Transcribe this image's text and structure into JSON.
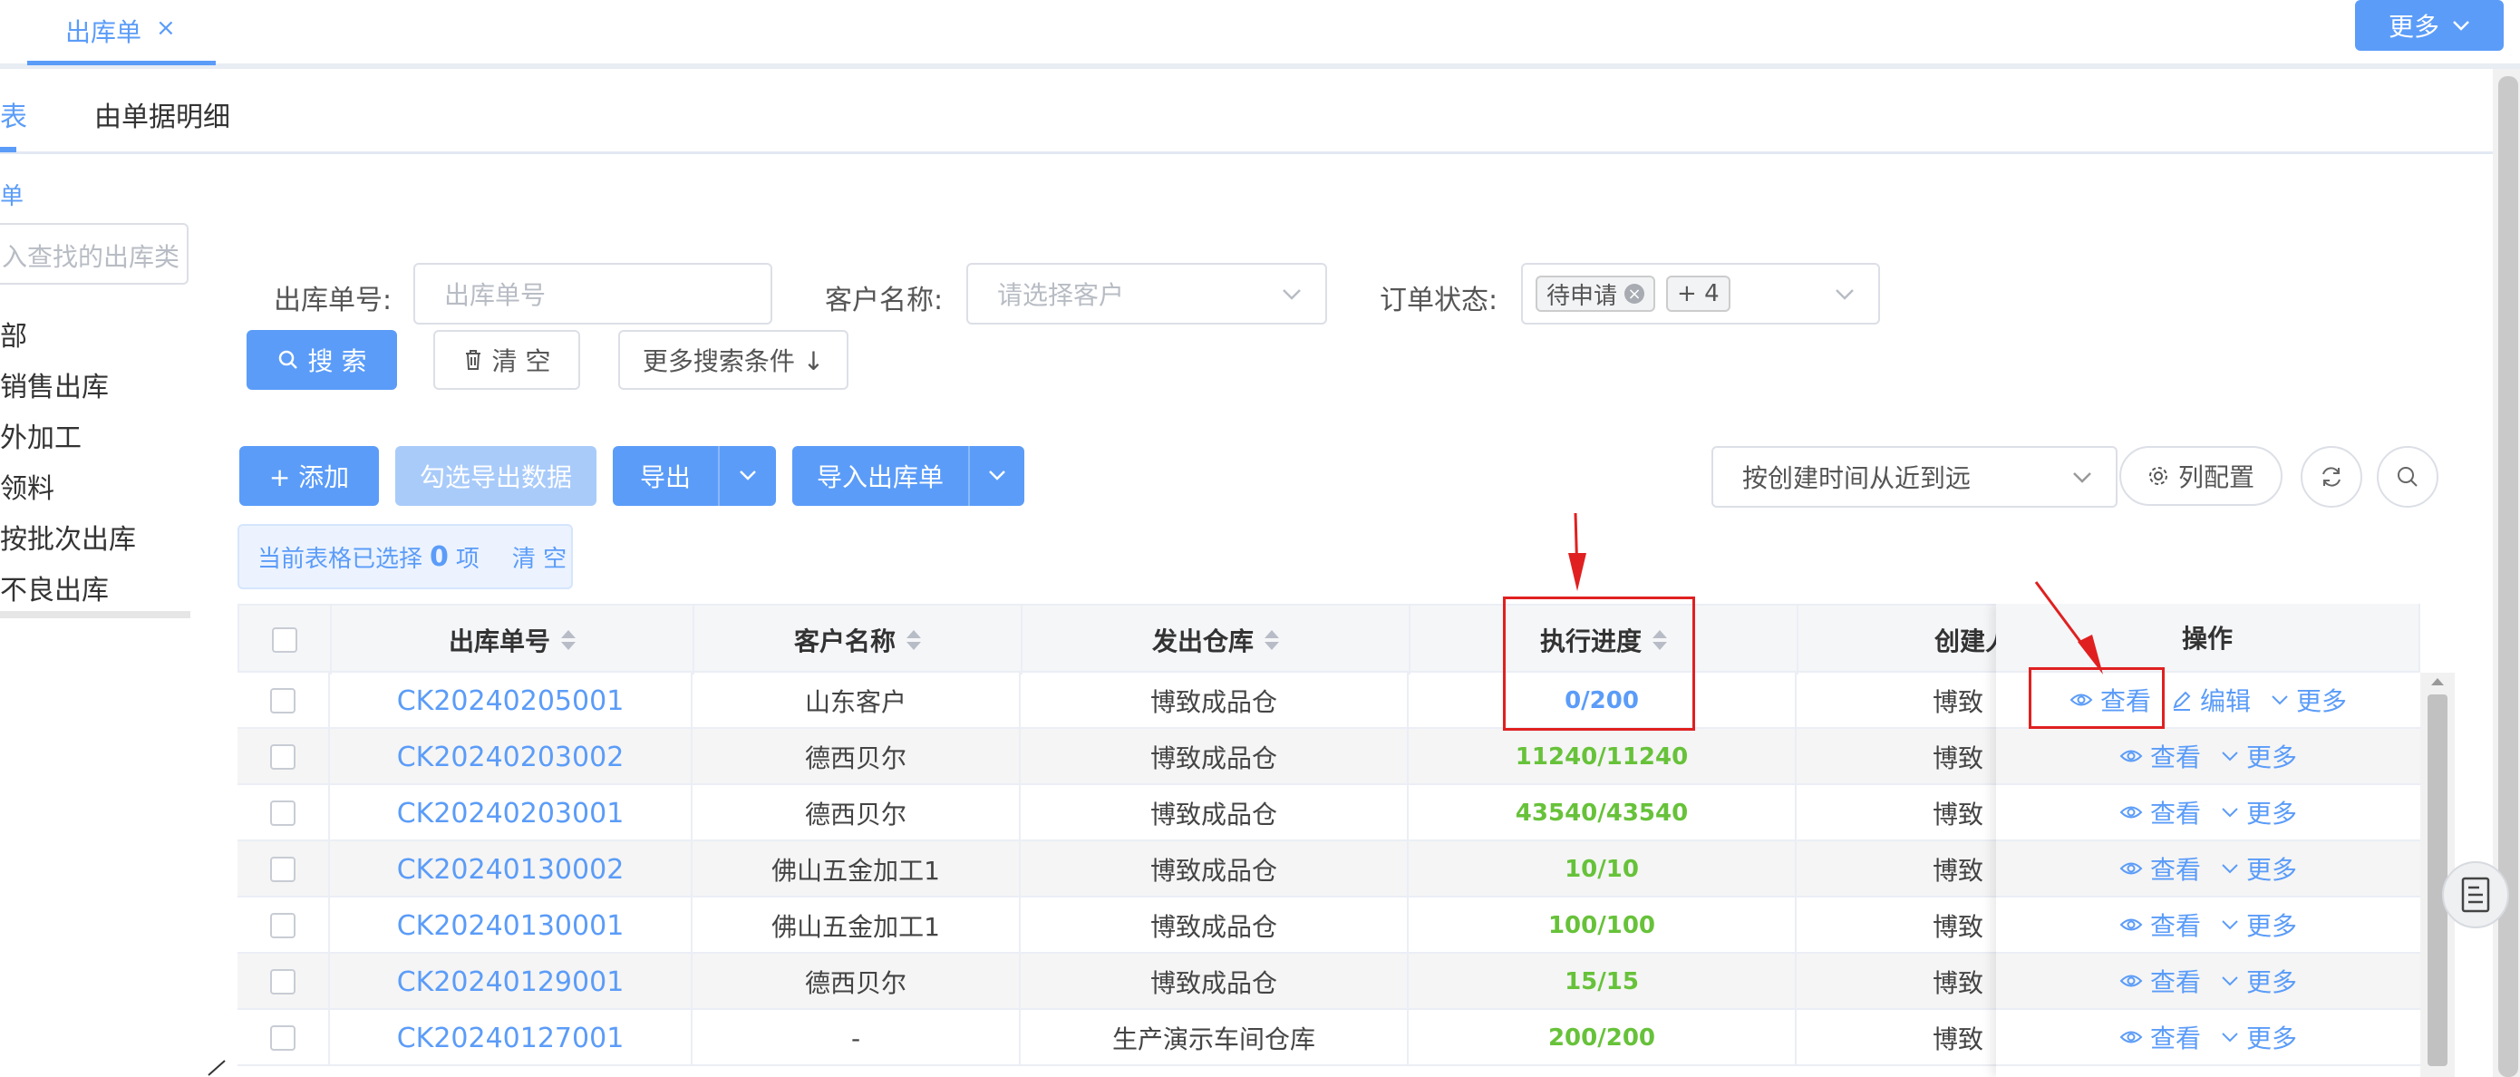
{
  "tabs": {
    "active_label": "出库单",
    "close_glyph": "×",
    "more_label": "更多"
  },
  "subtabs": {
    "left_partial": "表",
    "detail": "由单据明细"
  },
  "sidebar": {
    "header_partial": "单",
    "search_placeholder": "入查找的出库类",
    "items": [
      "部",
      "销售出库",
      "外加工",
      "领料",
      "按批次出库",
      "不良出库"
    ]
  },
  "filters": {
    "order_no_label": "出库单号:",
    "order_no_placeholder": "出库单号",
    "customer_label": "客户名称:",
    "customer_placeholder": "请选择客户",
    "status_label": "订单状态:",
    "status_tag": "待申请",
    "status_more": "+ 4",
    "search_btn": "搜 索",
    "clear_btn": "清 空",
    "more_conditions_btn": "更多搜索条件 ↓"
  },
  "toolbar": {
    "add_btn": "+ 添加",
    "export_selected_btn": "勾选导出数据",
    "export_btn": "导出",
    "import_btn": "导入出库单",
    "sort_select": "按创建时间从近到远",
    "columns_btn": "列配置"
  },
  "selection": {
    "prefix": "当前表格已选择",
    "count": "0",
    "suffix": "项",
    "clear": "清 空"
  },
  "table": {
    "headers": {
      "order_no": "出库单号",
      "customer": "客户名称",
      "warehouse": "发出仓库",
      "progress": "执行进度",
      "creator": "创建人",
      "ops": "操作"
    },
    "op_labels": {
      "view": "查看",
      "edit": "编辑",
      "more": "更多"
    },
    "rows": [
      {
        "order_no": "CK20240205001",
        "customer": "山东客户",
        "warehouse": "博致成品仓",
        "progress": "0/200",
        "creator": "博致"
      },
      {
        "order_no": "CK20240203002",
        "customer": "德西贝尔",
        "warehouse": "博致成品仓",
        "progress": "11240/11240",
        "creator": "博致"
      },
      {
        "order_no": "CK20240203001",
        "customer": "德西贝尔",
        "warehouse": "博致成品仓",
        "progress": "43540/43540",
        "creator": "博致"
      },
      {
        "order_no": "CK20240130002",
        "customer": "佛山五金加工1",
        "warehouse": "博致成品仓",
        "progress": "10/10",
        "creator": "博致"
      },
      {
        "order_no": "CK20240130001",
        "customer": "佛山五金加工1",
        "warehouse": "博致成品仓",
        "progress": "100/100",
        "creator": "博致"
      },
      {
        "order_no": "CK20240129001",
        "customer": "德西贝尔",
        "warehouse": "博致成品仓",
        "progress": "15/15",
        "creator": "博致"
      },
      {
        "order_no": "CK20240127001",
        "customer": "-",
        "warehouse": "生产演示车间仓库",
        "progress": "200/200",
        "creator": "博致"
      }
    ]
  },
  "colors": {
    "primary": "#5b9cf8",
    "success": "#67c23a",
    "annotation": "#e02020"
  }
}
